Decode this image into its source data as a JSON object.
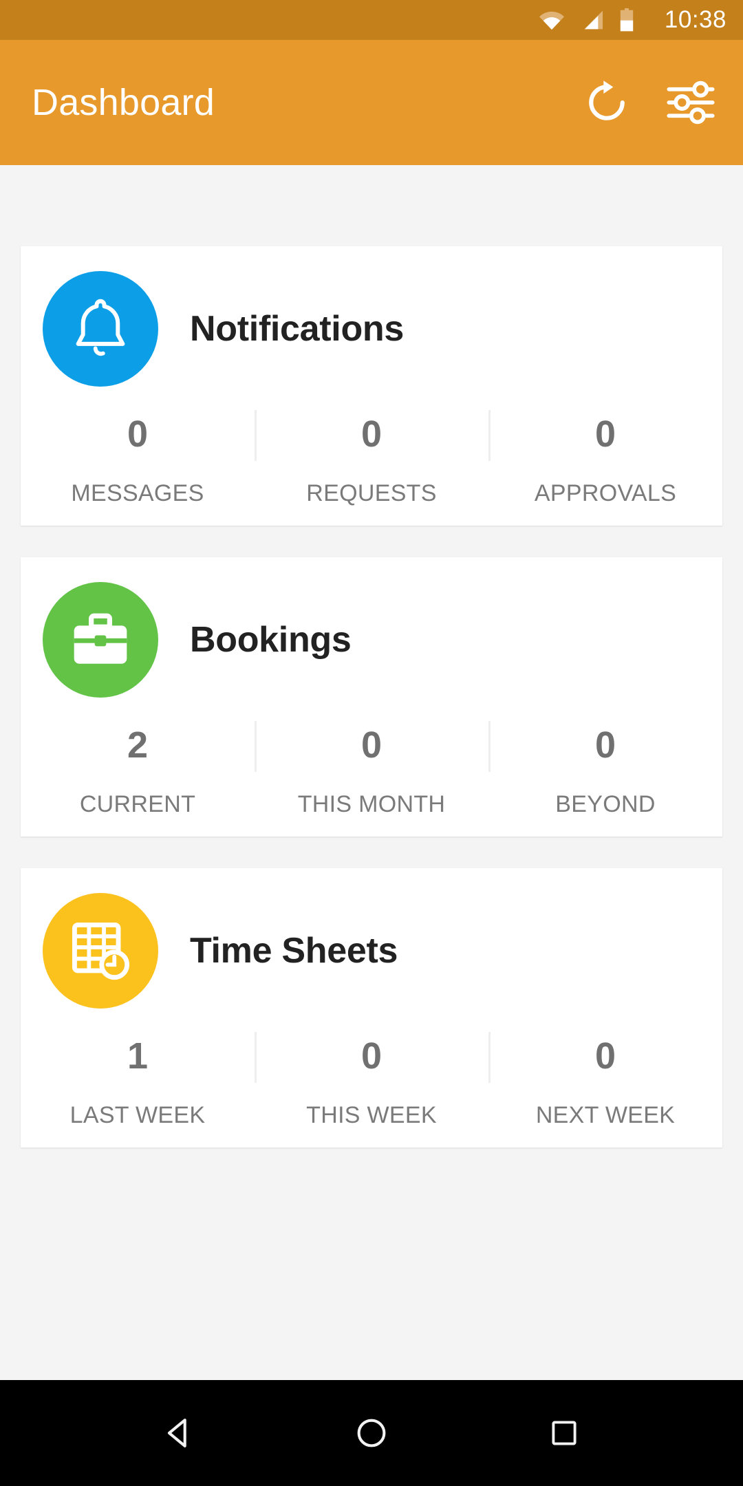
{
  "status_bar": {
    "time": "10:38",
    "icons": [
      "wifi-icon",
      "cell-signal-icon",
      "battery-icon"
    ],
    "background_color": "#c4801a"
  },
  "app_bar": {
    "title": "Dashboard",
    "background_color": "#e8992b",
    "actions": [
      {
        "name": "refresh-icon",
        "label": "Refresh"
      },
      {
        "name": "filter-settings-icon",
        "label": "Filter"
      }
    ]
  },
  "cards": [
    {
      "title": "Notifications",
      "icon": "bell-icon",
      "icon_color": "#0c9fe8",
      "stats": [
        {
          "value": "0",
          "label": "MESSAGES"
        },
        {
          "value": "0",
          "label": "REQUESTS"
        },
        {
          "value": "0",
          "label": "APPROVALS"
        }
      ]
    },
    {
      "title": "Bookings",
      "icon": "briefcase-icon",
      "icon_color": "#62c martial"
    }
  ],
  "nav_bar": {
    "background_color": "#000000",
    "buttons": [
      {
        "name": "back-button",
        "label": "Back"
      },
      {
        "name": "home-button",
        "label": "Home"
      },
      {
        "name": "recents-button",
        "label": "Recents"
      }
    ]
  },
  "page_background": "#f4f4f4"
}
